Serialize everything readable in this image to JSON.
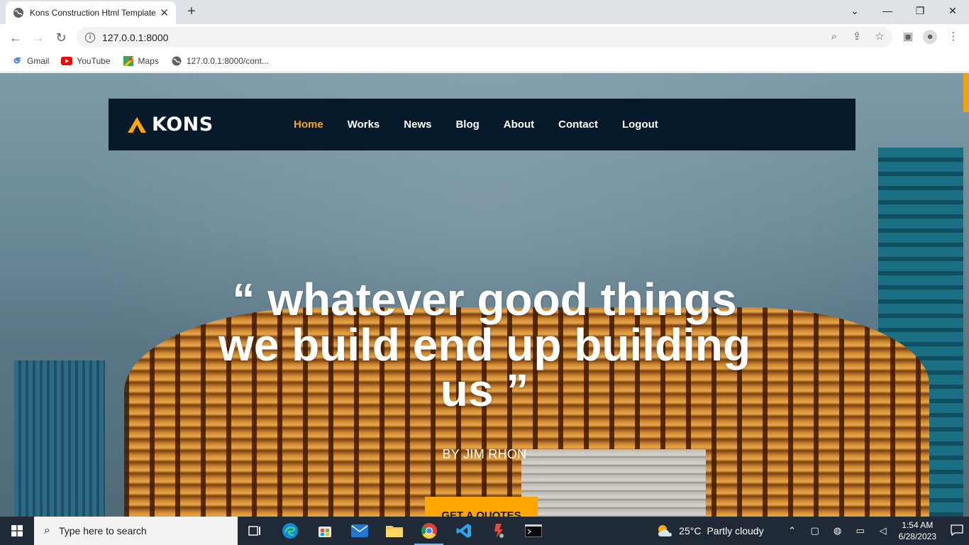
{
  "browser": {
    "tab_title": "Kons Construction Html Template",
    "tab_close": "✕",
    "new_tab": "+",
    "url": "127.0.0.1:8000",
    "bookmarks": [
      {
        "label": "Gmail",
        "icon": "gmail-icon"
      },
      {
        "label": "YouTube",
        "icon": "youtube-icon"
      },
      {
        "label": "Maps",
        "icon": "maps-icon"
      },
      {
        "label": "127.0.0.1:8000/cont...",
        "icon": "globe-icon"
      }
    ]
  },
  "site": {
    "logo_text": "KONS",
    "nav": [
      {
        "label": "Home",
        "active": true
      },
      {
        "label": "Works"
      },
      {
        "label": "News"
      },
      {
        "label": "Blog"
      },
      {
        "label": "About"
      },
      {
        "label": "Contact"
      },
      {
        "label": "Logout"
      }
    ],
    "quote": "“ whatever good things we build end up building us ”",
    "author": "BY JIM RHON",
    "cta_label": "GET A QUOTES",
    "accent": "#ffa600",
    "nav_bg": "#071a2c"
  },
  "taskbar": {
    "search_placeholder": "Type here to search",
    "weather_temp": "25°C",
    "weather_text": "Partly cloudy",
    "time": "1:54 AM",
    "date": "6/28/2023"
  }
}
